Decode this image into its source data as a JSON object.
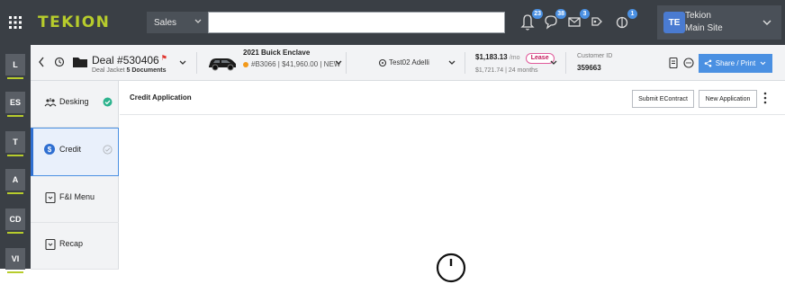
{
  "nav": {
    "logo": "TEKION",
    "module": "Sales",
    "search_value": "",
    "badges": {
      "bell": "23",
      "chat": "38",
      "mail": "3",
      "tag": "",
      "gift": "1"
    },
    "user": {
      "initials": "TE",
      "name": "Tekion",
      "site": "Main Site"
    }
  },
  "rail": [
    "L",
    "ES",
    "T",
    "A",
    "CD",
    "VI"
  ],
  "deal": {
    "title": "Deal #530406",
    "sub_label": "Deal Jacket",
    "sub_docs": "5 Documents",
    "vehicle_title": "2021 Buick Enclave",
    "vehicle_sub": "#B3066 | $41,960.00 | NEW",
    "customer": "Test02 Adelli",
    "payment": "$1,183.13",
    "payment_cycle": "/mo",
    "payment_type": "Lease",
    "payment_sub": "$1,721.74 | 24 months",
    "customer_id_label": "Customer ID",
    "customer_id": "359663",
    "share_label": "Share / Print"
  },
  "subnav": [
    {
      "label": "Desking",
      "status": "complete"
    },
    {
      "label": "Credit",
      "status": "pending"
    },
    {
      "label": "F&I Menu",
      "status": ""
    },
    {
      "label": "Recap",
      "status": ""
    }
  ],
  "main": {
    "title": "Credit Application",
    "submit_label": "Submit EContract",
    "new_label": "New Application"
  },
  "colors": {
    "accent": "#4a90e2",
    "brand": "#b7cc2c",
    "nav_bg": "#3a3f45",
    "success": "#2db38e",
    "flag": "#e0362f"
  }
}
